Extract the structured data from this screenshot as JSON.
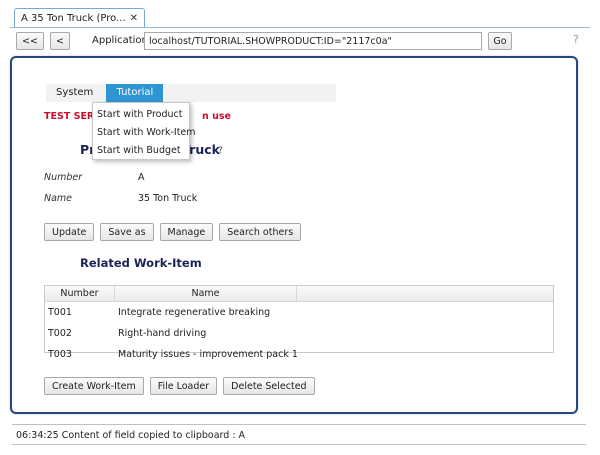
{
  "tab": {
    "title": "A 35 Ton Truck (Pro...",
    "close_icon": "close-icon"
  },
  "toolbar": {
    "first_label": "<<",
    "back_label": "<",
    "app_label": "Application",
    "url_value": "localhost/TUTORIAL.SHOWPRODUCT:ID=\"2117c0a\"",
    "go_label": "Go",
    "help_glyph": "?"
  },
  "menubar": {
    "items": [
      {
        "label": "System"
      },
      {
        "label": "Tutorial"
      }
    ],
    "active": "Tutorial"
  },
  "dropdown": {
    "items": [
      {
        "label": "Start with Product"
      },
      {
        "label": "Start with Work-Item"
      },
      {
        "label": "Start with Budget"
      }
    ]
  },
  "warning": {
    "visible_start": "TEST SERV",
    "visible_end": "n use"
  },
  "product": {
    "title_visible_start": "Pr",
    "title_visible_end": "Truck",
    "help_glyph": "?"
  },
  "fields": [
    {
      "label": "Number",
      "value": "A"
    },
    {
      "label": "Name",
      "value": "35 Ton Truck"
    }
  ],
  "actions": [
    "Update",
    "Save as",
    "Manage",
    "Search others"
  ],
  "related": {
    "title": "Related Work-Item",
    "columns": [
      "Number",
      "Name"
    ],
    "rows": [
      {
        "number": "T001",
        "name": "Integrate regenerative breaking"
      },
      {
        "number": "T002",
        "name": "Right-hand driving"
      },
      {
        "number": "T003",
        "name": "Maturity issues - improvement pack 1"
      }
    ]
  },
  "bottom_actions": [
    "Create Work-Item",
    "File Loader",
    "Delete Selected"
  ],
  "status": {
    "text": "06:34:25 Content of field copied to clipboard : A"
  },
  "colors": {
    "accent": "#2e95d3",
    "panel_border": "#26477f",
    "warning": "#c8102e",
    "heading": "#1a2456"
  }
}
